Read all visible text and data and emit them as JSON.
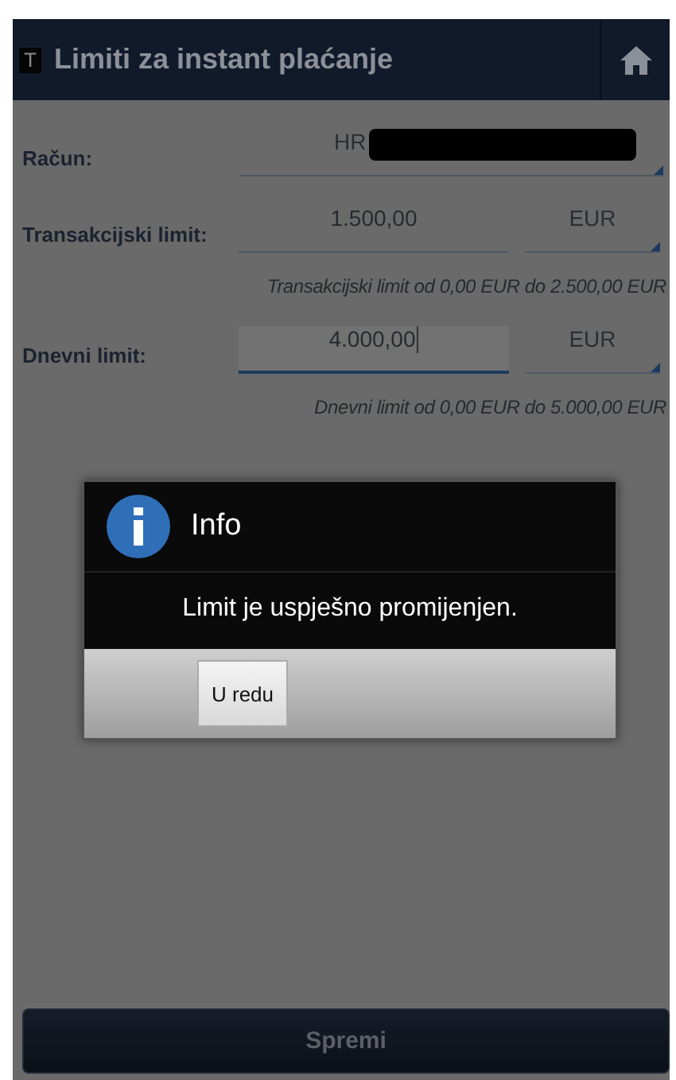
{
  "header": {
    "logo_letter": "T",
    "title": "Limiti za instant plaćanje"
  },
  "fields": [
    {
      "kind": "account",
      "label": "Račun:",
      "value": "HR",
      "redacted": true
    },
    {
      "kind": "amount",
      "label": "Transakcijski limit:",
      "value": "1.500,00",
      "currency": "EUR",
      "hint": "Transakcijski limit od 0,00 EUR do 2.500,00 EUR",
      "focused": false
    },
    {
      "kind": "amount",
      "label": "Dnevni limit:",
      "value": "4.000,00",
      "currency": "EUR",
      "hint": "Dnevni limit od 0,00 EUR do 5.000,00 EUR",
      "focused": true
    }
  ],
  "dialog": {
    "title": "Info",
    "message": "Limit je uspješno promijenjen.",
    "buttons": [
      "U redu"
    ]
  },
  "save_button": "Spremi"
}
